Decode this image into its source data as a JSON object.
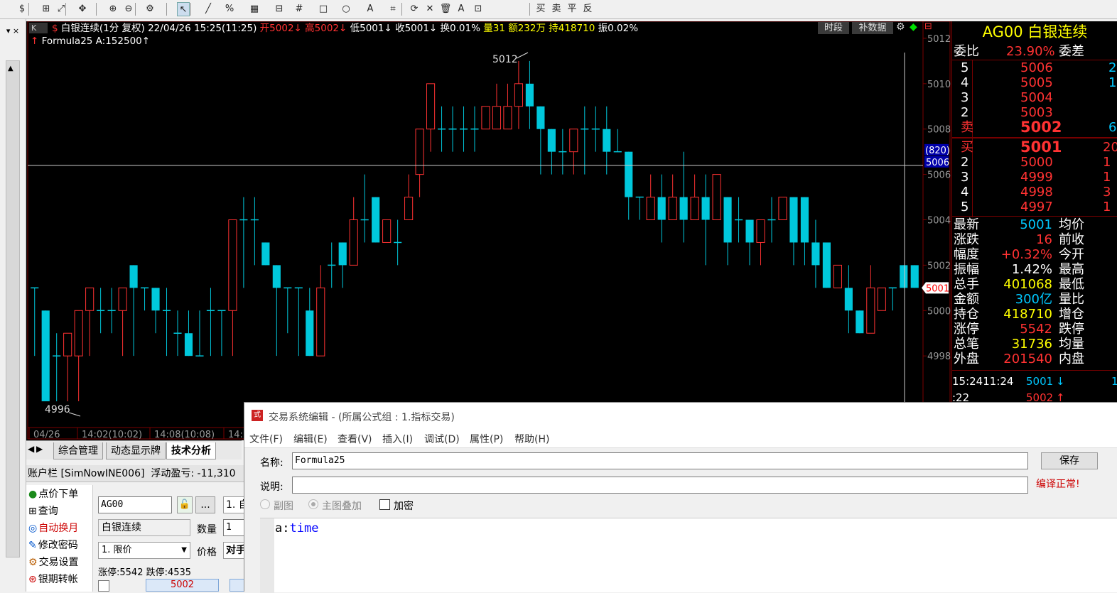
{
  "toolbar": {
    "items": [
      "$",
      "⊞",
      "⤢",
      "✥",
      "⊕",
      "⊖",
      "⚙",
      "↖",
      "╱",
      "%",
      "▦",
      "⊟",
      "#",
      "□",
      "○",
      "A",
      "⌗",
      "⟳",
      "✕",
      "🗑",
      "A",
      "⊡"
    ],
    "trade": [
      "买",
      "卖",
      "平",
      "反"
    ]
  },
  "chart": {
    "title": "白银连续(1分 复权) 22/04/26 15:25(11:25)",
    "open": "开5002↓",
    "high": "高5002↓",
    "low": "低5001↓",
    "close": "收5001↓",
    "turnover": "换0.01%",
    "vol": "量31",
    "amount": "额232万",
    "hold": "持418710",
    "amp": "振0.02%",
    "formula": "Formula25 A:152500↑",
    "btn1": "时段",
    "btn2": "补数据",
    "yticks": [
      "5012",
      "5010",
      "5008",
      "5006",
      "5004",
      "5002",
      "5000",
      "4998"
    ],
    "crosshair_label": "(820)",
    "crosshair_value": "5006",
    "last_label": "5001",
    "maxlabel": "5012",
    "minlabel": "4996",
    "xlabels": [
      "04/26",
      "14:02(10:02)",
      "14:08(10:08)",
      "14:1"
    ],
    "kbtn": "K",
    "colors": {
      "up": "#ff3232",
      "down": "#00c8dc",
      "grid": "#7a0000"
    }
  },
  "chart_data": {
    "type": "candlestick",
    "ylim": [
      4995,
      5013
    ],
    "candles": [
      [
        5001,
        5001,
        4998,
        5001
      ],
      [
        5000,
        4996,
        4996,
        5000
      ],
      [
        4998,
        4998,
        4996,
        4999
      ],
      [
        4998,
        4999,
        4996,
        4999
      ],
      [
        4998,
        5000,
        4996,
        5000
      ],
      [
        5000,
        5001,
        4998,
        5000
      ],
      [
        5000,
        5000,
        4999,
        5001
      ],
      [
        5000,
        5000,
        4999,
        5001
      ],
      [
        5000,
        5001,
        4998,
        5001
      ],
      [
        5002,
        5001,
        4998,
        5002
      ],
      [
        5001,
        5001,
        5000,
        5001
      ],
      [
        5001,
        5000,
        4999,
        5001
      ],
      [
        5000,
        5000,
        4998,
        5001
      ],
      [
        4999,
        4999,
        4998,
        5000
      ],
      [
        4999,
        4998,
        4998,
        5000
      ],
      [
        4998,
        4998,
        4998,
        5000
      ],
      [
        5000,
        5000,
        4998,
        5001
      ],
      [
        5000,
        5000,
        4998,
        5000
      ],
      [
        5000,
        5004,
        4998,
        5004
      ],
      [
        5004,
        5004,
        5001,
        5005
      ],
      [
        5004,
        5004,
        5002,
        5005
      ],
      [
        5003,
        5002,
        5002,
        5003
      ],
      [
        5002,
        5001,
        4998,
        5002
      ],
      [
        5001,
        5001,
        4999,
        5001
      ],
      [
        5001,
        5001,
        4998,
        5001
      ],
      [
        5000,
        4998,
        4998,
        5001
      ],
      [
        4998,
        5001,
        4998,
        5002
      ],
      [
        5002,
        5002,
        5001,
        5003
      ],
      [
        5003,
        5002,
        5001,
        5003
      ],
      [
        5002,
        5004,
        5002,
        5005
      ],
      [
        5004,
        5004,
        5003,
        5006
      ],
      [
        5005,
        5003,
        5003,
        5005
      ],
      [
        5003,
        5004,
        5003,
        5004
      ],
      [
        5003,
        5003,
        5002,
        5004
      ],
      [
        5004,
        5005,
        5004,
        5006
      ],
      [
        5006,
        5008,
        5005,
        5008
      ],
      [
        5008,
        5010,
        5007,
        5010
      ],
      [
        5008,
        5008,
        5007,
        5009
      ],
      [
        5008,
        5008,
        5007,
        5009
      ],
      [
        5008,
        5008,
        5007,
        5009
      ],
      [
        5008,
        5008,
        5007,
        5009
      ],
      [
        5008,
        5009,
        5008,
        5009
      ],
      [
        5008,
        5009,
        5008,
        5010
      ],
      [
        5008,
        5009,
        5008,
        5010
      ],
      [
        5009,
        5010,
        5008,
        5011
      ],
      [
        5010,
        5009,
        5008,
        5011
      ],
      [
        5009,
        5008,
        5006,
        5009
      ],
      [
        5008,
        5007,
        5006,
        5008
      ],
      [
        5007,
        5007,
        5006,
        5008
      ],
      [
        5007,
        5008,
        5006,
        5008
      ],
      [
        5008,
        5008,
        5006,
        5009
      ],
      [
        5008,
        5008,
        5007,
        5009
      ],
      [
        5008,
        5007,
        5006,
        5009
      ],
      [
        5007,
        5007,
        5007,
        5008
      ],
      [
        5007,
        5005,
        5004,
        5007
      ],
      [
        5005,
        5005,
        5004,
        5005
      ],
      [
        5004,
        5005,
        5004,
        5006
      ],
      [
        5005,
        5004,
        5003,
        5006
      ],
      [
        5004,
        5005,
        5004,
        5006
      ],
      [
        5005,
        5004,
        5003,
        5007
      ],
      [
        5004,
        5005,
        5004,
        5006
      ],
      [
        5005,
        5004,
        5002,
        5006
      ],
      [
        5004,
        5006,
        5004,
        5006
      ],
      [
        5005,
        5003,
        5002,
        5005
      ],
      [
        5004,
        5004,
        5003,
        5005
      ],
      [
        5004,
        5003,
        5002,
        5004
      ],
      [
        5003,
        5004,
        5002,
        5004
      ],
      [
        5004,
        5004,
        5003,
        5005
      ],
      [
        5004,
        5005,
        5004,
        5005
      ],
      [
        5005,
        5003,
        5002,
        5005
      ],
      [
        5005,
        5003,
        5002,
        5005
      ],
      [
        5003,
        5002,
        5001,
        5004
      ],
      [
        5003,
        5001,
        5001,
        5002
      ],
      [
        5001,
        5002,
        5002,
        5002
      ],
      [
        5001,
        5000,
        4999,
        5002
      ],
      [
        5000,
        4999,
        4999,
        5000
      ],
      [
        4999,
        5001,
        5000,
        5002
      ],
      [
        5000,
        5001,
        5000,
        5001
      ],
      [
        5001,
        5001,
        5000,
        5001
      ],
      [
        5002,
        5001,
        5001,
        5002
      ],
      [
        5002,
        5001,
        5001,
        5002
      ]
    ]
  },
  "right": {
    "code": "AG00",
    "name": "白银连续",
    "wbi_label": "委比",
    "wbi": "23.90%",
    "wc_label": "委差",
    "asks": [
      {
        "lvl": "5",
        "p": "5006",
        "v": "2"
      },
      {
        "lvl": "4",
        "p": "5005",
        "v": "1"
      },
      {
        "lvl": "3",
        "p": "5004",
        "v": ""
      },
      {
        "lvl": "2",
        "p": "5003",
        "v": ""
      },
      {
        "lvl": "卖",
        "p": "5002",
        "v": "6"
      }
    ],
    "bids": [
      {
        "lvl": "买",
        "p": "5001",
        "v": "20"
      },
      {
        "lvl": "2",
        "p": "5000",
        "v": "1"
      },
      {
        "lvl": "3",
        "p": "4999",
        "v": "1"
      },
      {
        "lvl": "4",
        "p": "4998",
        "v": "3"
      },
      {
        "lvl": "5",
        "p": "4997",
        "v": "1"
      }
    ],
    "stats": [
      {
        "k": "最新",
        "v": "5001",
        "k2": "均价",
        "c": "#00c8ff"
      },
      {
        "k": "涨跌",
        "v": "16",
        "k2": "前收",
        "c": "#ff3232"
      },
      {
        "k": "幅度",
        "v": "+0.32%",
        "k2": "今开",
        "c": "#ff3232"
      },
      {
        "k": "振幅",
        "v": "1.42%",
        "k2": "最高",
        "c": "#ffffff"
      },
      {
        "k": "总手",
        "v": "401068",
        "k2": "最低",
        "c": "#ffff00"
      },
      {
        "k": "金额",
        "v": "300亿",
        "k2": "量比",
        "c": "#00c8ff"
      },
      {
        "k": "持仓",
        "v": "418710",
        "k2": "增仓",
        "c": "#ffff00"
      },
      {
        "k": "涨停",
        "v": "5542",
        "k2": "跌停",
        "c": "#ff3232"
      },
      {
        "k": "总笔",
        "v": "31736",
        "k2": "均量",
        "c": "#ffff00"
      },
      {
        "k": "外盘",
        "v": "201540",
        "k2": "内盘",
        "c": "#ff3232"
      }
    ],
    "ticks": [
      {
        "t": "15:2411:24",
        "p": "5001",
        "a": "↓",
        "v": "1",
        "c": "#00c8ff"
      },
      {
        "t": ":22",
        "p": "5002",
        "a": "↑",
        "v": "",
        "c": "#ff3232"
      }
    ]
  },
  "tabs": [
    "综合管理",
    "动态显示牌",
    "技术分析"
  ],
  "account": {
    "title": "账户栏 [SimNowINE006]",
    "pnl": "浮动盈亏: -11,310",
    "menu": [
      {
        "icon": "●",
        "label": "点价下单",
        "c": "#1a8a1a"
      },
      {
        "icon": "⊞",
        "label": "查询",
        "c": "#000"
      },
      {
        "icon": "◎",
        "label": "自动换月",
        "c": "#0055cc"
      },
      {
        "icon": "✎",
        "label": "修改密码",
        "c": "#0055cc"
      },
      {
        "icon": "⚙",
        "label": "交易设置",
        "c": "#b85c00"
      },
      {
        "icon": "⊛",
        "label": "银期转帐",
        "c": "#cc0000"
      }
    ],
    "code": "AG00",
    "name": "白银连续",
    "qty_label": "数量",
    "qty": "1",
    "price_label": "价格",
    "order_type": "1. 限价",
    "price_val": "对手",
    "limits": "涨停:5542  跌停:4535",
    "dots": "...",
    "auto": "1. 自",
    "bottom_price": "5002"
  },
  "dialog": {
    "title": "交易系统编辑 - (所属公式组 : 1.指标交易)",
    "menu": [
      "文件(F)",
      "编辑(E)",
      "查看(V)",
      "插入(I)",
      "调试(D)",
      "属性(P)",
      "帮助(H)"
    ],
    "name_label": "名称:",
    "name_value": "Formula25",
    "desc_label": "说明:",
    "desc_value": "",
    "save": "保存",
    "status": "编译正常!",
    "radio1": "副图",
    "radio2": "主图叠加",
    "checkbox": "加密",
    "code_a": "a:",
    "code_b": "time"
  }
}
